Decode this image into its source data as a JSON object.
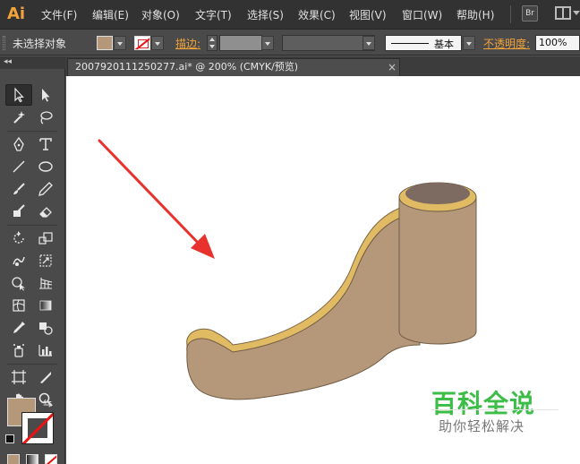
{
  "app": {
    "logo": "Ai"
  },
  "menu": [
    "文件(F)",
    "编辑(E)",
    "对象(O)",
    "文字(T)",
    "选择(S)",
    "效果(C)",
    "视图(V)",
    "窗口(W)",
    "帮助(H)"
  ],
  "menubar_right": {
    "bridge_label": "Br"
  },
  "controlbar": {
    "selection_status": "未选择对象",
    "fill_color": "#b5977a",
    "stroke_label": "描边:",
    "stroke_style_label": "基本",
    "opacity_label": "不透明度:",
    "opacity_value": "100%"
  },
  "document": {
    "tab_title": "2007920111250277.ai* @ 200% (CMYK/预览)",
    "close_glyph": "×"
  },
  "toolpanel": {
    "collapse_glyph": "◂◂",
    "swap_glyph": "⇆"
  },
  "artwork": {
    "object_fill": "#b5977a",
    "object_edge": "#e0bb63",
    "cap_top": "#7d6a60",
    "arrow_color": "#e8322d"
  },
  "watermark": {
    "title": "百科全说",
    "subtitle": "助你轻松解决"
  }
}
